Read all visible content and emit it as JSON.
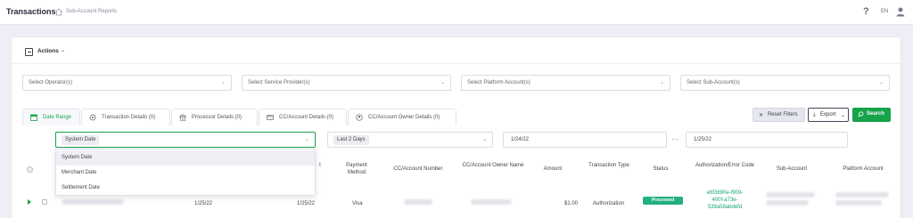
{
  "header": {
    "title": "Transactions",
    "breadcrumb": "Sub-Account Reports",
    "help_label": "?",
    "language": "EN"
  },
  "actions": {
    "label": "Actions",
    "chevron": "⌄"
  },
  "filters": [
    {
      "placeholder": "Select Operator(s)"
    },
    {
      "placeholder": "Select Service Provider(s)"
    },
    {
      "placeholder": "Select Platform Account(s)"
    },
    {
      "placeholder": "Select Sub-Account(s)"
    }
  ],
  "tabs": [
    {
      "label": "Date Range",
      "icon": "calendar-icon",
      "active": true
    },
    {
      "label": "Transaction Details (0)",
      "icon": "gear-icon",
      "active": false
    },
    {
      "label": "Processor Details (0)",
      "icon": "bank-icon",
      "active": false
    },
    {
      "label": "CC/Account Details (0)",
      "icon": "card-icon",
      "active": false
    },
    {
      "label": "CC/Account Owner Details (0)",
      "icon": "user-icon",
      "active": false
    }
  ],
  "buttons": {
    "reset": "Reset Filters",
    "export": "Export",
    "search": "Search"
  },
  "date_filter": {
    "date_type": "System Date",
    "range": "Last 2 Days",
    "start": "1/24/22",
    "separator": "···",
    "end": "1/25/22"
  },
  "date_type_options": [
    "System Date",
    "Merchant Date",
    "Settlement Date"
  ],
  "table": {
    "columns": {
      "t": "t",
      "payment_method": "Payment Method",
      "account_number": "CC/Account Number",
      "owner_name": "CC/Account Owner Name",
      "amount": "Amount",
      "txn_type": "Transaction Type",
      "status": "Status",
      "auth_code": "Authorization/Error Code",
      "sub_account": "Sub-Account",
      "platform_account": "Platform Account"
    },
    "row": {
      "date1": "1/25/22",
      "date2": "1/25/22",
      "payment_method": "Visa",
      "amount": "$1.00",
      "txn_type": "Authorization",
      "status": "Processed",
      "auth_code": "e6f3690e-f909-400f-a73e-539a58abdefd"
    }
  },
  "colors": {
    "accent": "#16a34a",
    "status_processed": "#22b07d",
    "link": "#14a67e"
  }
}
